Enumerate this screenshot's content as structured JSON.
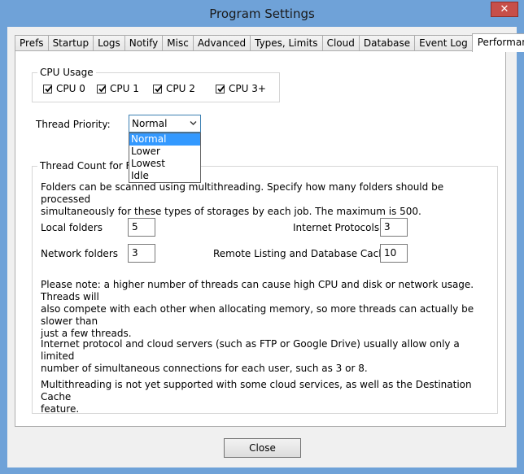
{
  "window": {
    "title": "Program Settings",
    "close_glyph": "✕"
  },
  "tabs": [
    {
      "label": "Prefs"
    },
    {
      "label": "Startup"
    },
    {
      "label": "Logs"
    },
    {
      "label": "Notify"
    },
    {
      "label": "Misc"
    },
    {
      "label": "Advanced"
    },
    {
      "label": "Types, Limits"
    },
    {
      "label": "Cloud"
    },
    {
      "label": "Database"
    },
    {
      "label": "Event Log"
    },
    {
      "label": "Performance",
      "active": true
    }
  ],
  "cpu_usage": {
    "legend": "CPU Usage",
    "items": [
      {
        "label": "CPU 0",
        "checked": true
      },
      {
        "label": "CPU 1",
        "checked": true
      },
      {
        "label": "CPU 2",
        "checked": true
      },
      {
        "label": "CPU 3+",
        "checked": true
      }
    ]
  },
  "thread_priority": {
    "label": "Thread Priority:",
    "selected": "Normal",
    "options": [
      "Normal",
      "Lower",
      "Lowest",
      "Idle"
    ]
  },
  "thread_count": {
    "legend": "Thread Count for F",
    "intro_line1": "Folders can be scanned using multithreading. Specify how many folders should be processed",
    "intro_line2": "simultaneously for these types of storages by each job. The maximum is 500.",
    "local_folders_label": "Local folders",
    "local_folders_value": "5",
    "network_folders_label": "Network folders",
    "network_folders_value": "3",
    "internet_protocols_label": "Internet Protocols",
    "internet_protocols_value": "3",
    "remote_listing_label": "Remote Listing and Database Cache",
    "remote_listing_value": "10",
    "note1_line1": "Please note: a higher number of threads can cause high CPU and disk or network usage. Threads will",
    "note1_line2": "also compete with each other when allocating memory, so more threads can actually be slower than",
    "note1_line3": "just a few threads.",
    "note2_line1": "Internet protocol and cloud servers (such as FTP or Google Drive) usually allow only a limited",
    "note2_line2": "number of simultaneous connections for each user, such as 3 or 8.",
    "note3_line1": "Multithreading is not yet supported with some cloud services, as well as the Destination Cache",
    "note3_line2": "feature."
  },
  "footer": {
    "close_label": "Close"
  }
}
